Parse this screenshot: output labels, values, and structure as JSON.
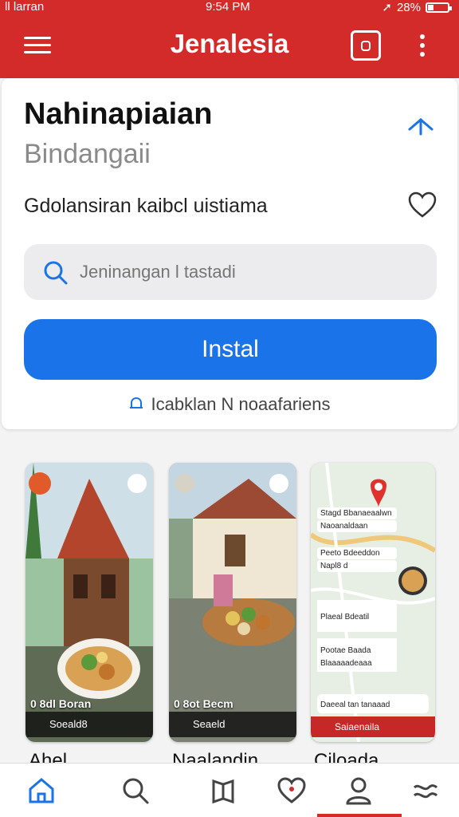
{
  "status": {
    "carrier": "ll larran",
    "time": "9:54 PM",
    "battery": "28%",
    "battery_level": 0.28
  },
  "appbar": {
    "title": "Jenalesia"
  },
  "app": {
    "name": "Nahinapiaian",
    "developer": "Bindangaii",
    "subtitle": "Gdolansiran kaibcl uistiama"
  },
  "search": {
    "placeholder": "Jeninangan l tastadi"
  },
  "install": {
    "label": "Instal"
  },
  "notice": {
    "text": "Icabklan N noaafariens"
  },
  "screenshots": [
    {
      "caption": "0 8dl Boran",
      "label": "Soeald8",
      "title": "Ahel"
    },
    {
      "caption": "0 8ot Becm",
      "label": "Seaeld",
      "title": "Naalandin"
    },
    {
      "map_lines": [
        "Stagd Bbanaeaalwn",
        "Naoanaldaan",
        "Peeto Bdeeddon",
        "Napl8 d"
      ],
      "list_items": [
        "Plaeal Bdeatil",
        "Pootae Baada",
        "Blaaaaadeaaa",
        "Daeeal tan tanaaad"
      ],
      "label": "Saiaenaila",
      "title": "Ciloada"
    }
  ],
  "colors": {
    "brand": "#d32a2a",
    "accent": "#1a73e8"
  },
  "nav": {
    "items": [
      "home-icon",
      "search-icon",
      "library-icon",
      "favorites-icon",
      "profile-icon",
      "more-icon"
    ],
    "active": "profile-icon"
  }
}
